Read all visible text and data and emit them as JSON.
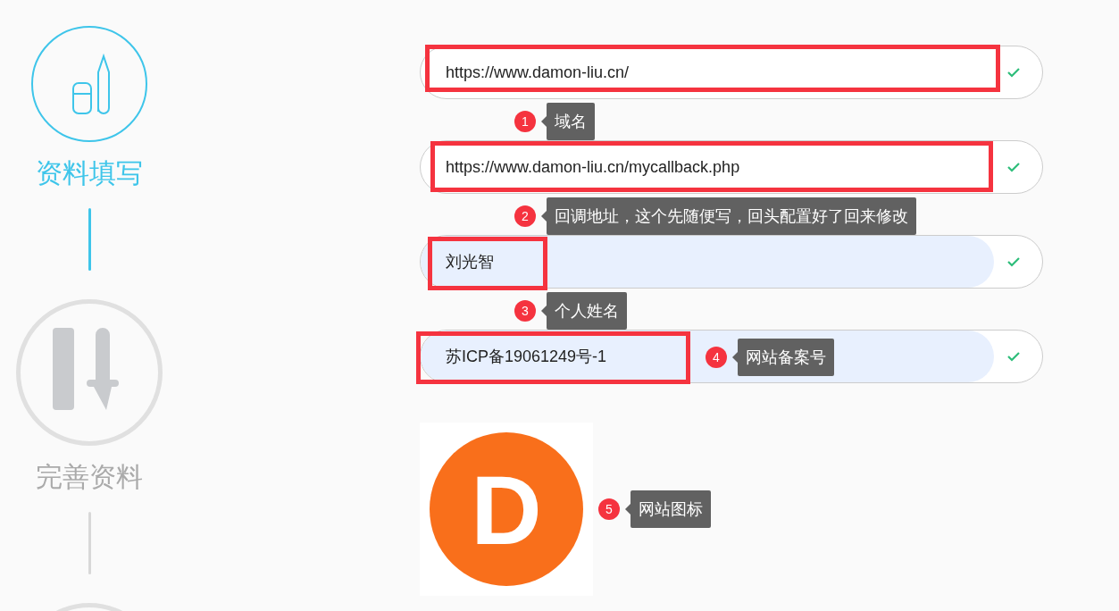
{
  "steps": [
    {
      "kind": "edit",
      "label": "资料填写",
      "active": true
    },
    {
      "kind": "tools",
      "label": "完善资料",
      "active": false
    },
    {
      "active": false
    }
  ],
  "form": {
    "items": [
      {
        "kind": "field",
        "value": "https://www.damon-liu.cn/",
        "autofilled": false,
        "valid": true,
        "highlighted": true
      },
      {
        "kind": "note",
        "number": "1",
        "text": "域名"
      },
      {
        "kind": "field",
        "value": "https://www.damon-liu.cn/mycallback.php",
        "autofilled": false,
        "valid": true,
        "highlighted": true
      },
      {
        "kind": "note",
        "number": "2",
        "text": "回调地址，这个先随便写，回头配置好了回来修改"
      },
      {
        "kind": "field",
        "value": "刘光智",
        "autofilled": true,
        "valid": true,
        "highlighted": true
      },
      {
        "kind": "note",
        "number": "3",
        "text": "个人姓名"
      },
      {
        "kind": "field",
        "value": "苏ICP备19061249号-1",
        "autofilled": true,
        "valid": true,
        "highlighted": true,
        "note": {
          "number": "4",
          "text": "网站备案号"
        }
      }
    ],
    "logo": {
      "letter": "D",
      "note": {
        "number": "5",
        "text": "网站图标"
      }
    }
  }
}
